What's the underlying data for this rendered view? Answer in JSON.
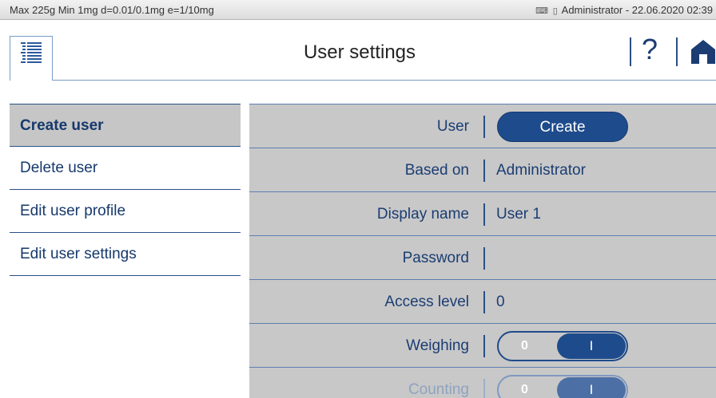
{
  "status": {
    "scale_info": "Max 225g  Min 1mg  d=0.01/0.1mg  e=1/10mg",
    "user_time": "Administrator  -  22.06.2020 02:39",
    "icons": [
      "printer-icon",
      "battery-icon"
    ]
  },
  "header": {
    "title": "User settings",
    "help_label": "?",
    "icons": [
      "menu-list-icon",
      "help-icon",
      "home-icon"
    ]
  },
  "side_menu": {
    "items": [
      {
        "label": "Create user",
        "active": true
      },
      {
        "label": "Delete user",
        "active": false
      },
      {
        "label": "Edit user profile",
        "active": false
      },
      {
        "label": "Edit user settings",
        "active": false
      }
    ]
  },
  "form": {
    "rows": [
      {
        "label": "User",
        "type": "button",
        "value": "Create"
      },
      {
        "label": "Based on",
        "type": "text",
        "value": "Administrator"
      },
      {
        "label": "Display name",
        "type": "text",
        "value": "User 1"
      },
      {
        "label": "Password",
        "type": "text",
        "value": ""
      },
      {
        "label": "Access level",
        "type": "text",
        "value": "0"
      },
      {
        "label": "Weighing",
        "type": "toggle",
        "off_label": "0",
        "on_label": "I",
        "state": "on"
      },
      {
        "label": "Counting",
        "type": "toggle",
        "off_label": "0",
        "on_label": "I",
        "state": "on"
      }
    ]
  },
  "colors": {
    "accent": "#1e4b8c",
    "panel": "#c8c8c8",
    "active_item": "#c6c6c6",
    "text": "#1b3d73"
  }
}
